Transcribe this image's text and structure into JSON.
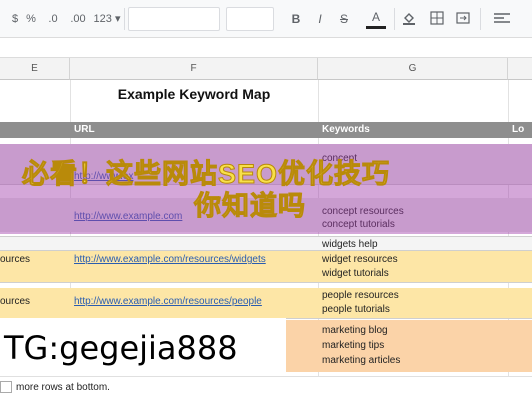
{
  "toolbar": {
    "currency": "$",
    "percent": "%",
    "decimal_less": ".0",
    "decimal_more": ".00",
    "format_more": "123 ▾",
    "bold": "B",
    "italic": "I",
    "strike": "S",
    "text_color": "A"
  },
  "columns": [
    "E",
    "F",
    "G"
  ],
  "sheet": {
    "title": "Example Keyword Map",
    "headers": {
      "url": "URL",
      "keywords": "Keywords",
      "truncated": "Lo"
    },
    "rows": [
      {
        "url": "http://www.ex",
        "keywords": [
          "concept"
        ]
      },
      {
        "url": "http://www.example.com",
        "keywords": [
          "concept resources",
          "concept tutorials"
        ]
      },
      {
        "label": "",
        "keywords": [
          "widgets help"
        ]
      },
      {
        "label": "ources",
        "url": "http://www.example.com/resources/widgets",
        "keywords": [
          "widget resources",
          "widget tutorials"
        ]
      },
      {
        "label": "ources",
        "url": "http://www.example.com/resources/people",
        "keywords": [
          "people resources",
          "people tutorials"
        ]
      },
      {
        "keywords": [
          "marketing blog",
          "marketing tips",
          "marketing articles"
        ]
      }
    ],
    "footer_text": "more rows at bottom."
  },
  "overlay": {
    "banner_line1": "必看！这些网站SEO优化技巧",
    "banner_line2": "你知道吗",
    "contact": "TG:gegejia888"
  }
}
